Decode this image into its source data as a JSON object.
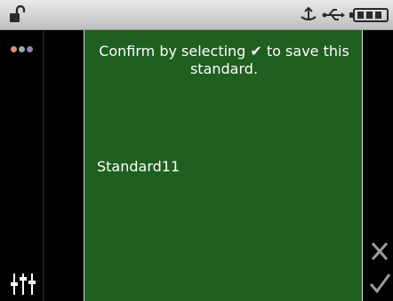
{
  "status_bar": {
    "icons": [
      "lock-open-icon",
      "usb-plug-icon",
      "usb-icon",
      "battery-icon"
    ]
  },
  "sidebar": {
    "menu_dot_colors": [
      "#e08a7a",
      "#8fb0a0",
      "#a07ab0"
    ],
    "settings_icon": "sliders-icon"
  },
  "panel": {
    "message": "Confirm by selecting ✔ to save this standard.",
    "standard_name": "Standard11",
    "background": "#1f5f1f"
  },
  "actions": {
    "cancel_icon": "x-icon",
    "confirm_icon": "check-icon"
  }
}
